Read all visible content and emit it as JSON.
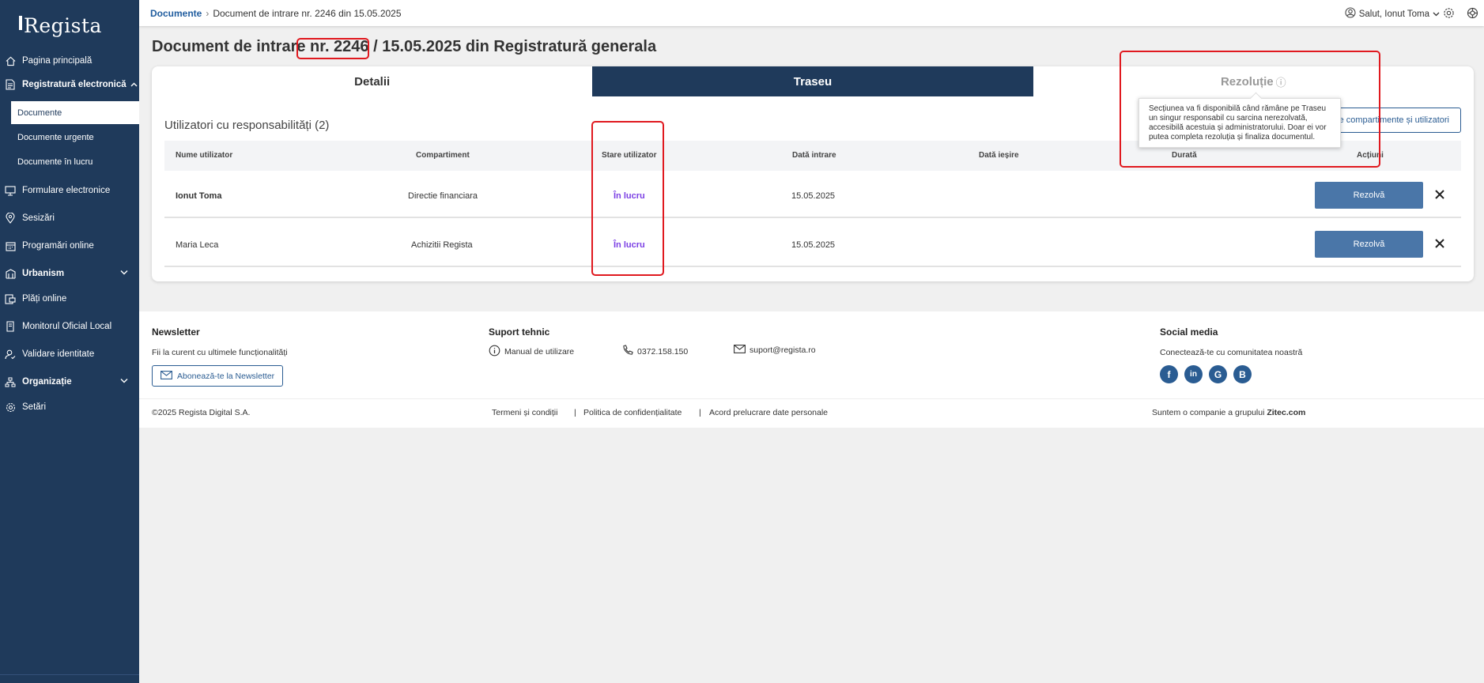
{
  "app": {
    "logo": "Regista"
  },
  "sidebar": {
    "items": [
      {
        "label": "Pagina principală"
      },
      {
        "label": "Registratură electronică"
      },
      {
        "label": "Formulare electronice"
      },
      {
        "label": "Sesizări"
      },
      {
        "label": "Programări online"
      },
      {
        "label": "Urbanism"
      },
      {
        "label": "Plăți online"
      },
      {
        "label": "Monitorul Oficial Local"
      },
      {
        "label": "Validare identitate"
      },
      {
        "label": "Organizație"
      },
      {
        "label": "Setări"
      }
    ],
    "subitems": [
      {
        "label": "Documente",
        "active": true
      },
      {
        "label": "Documente urgente"
      },
      {
        "label": "Documente în lucru"
      }
    ]
  },
  "header": {
    "breadcrumb_root": "Documente",
    "breadcrumb_sep": "›",
    "breadcrumb_current": "Document de intrare nr. 2246 din 15.05.2025",
    "user_greeting": "Salut, Ionut Toma"
  },
  "page": {
    "title_prefix": "Document de intrare ",
    "title_number": "nr. 2246",
    "title_suffix": " / 15.05.2025 din Registratură generala"
  },
  "tabs": [
    {
      "label": "Detalii"
    },
    {
      "label": "Traseu"
    },
    {
      "label": "Rezoluție",
      "info": "ⓘ"
    }
  ],
  "tooltip": {
    "text": "Secțiunea va fi disponibilă când rămâne pe Traseu un singur responsabil cu sarcina nerezolvată, accesibilă acestuia și administratorului. Doar ei vor putea completa rezoluția și finaliza documentul."
  },
  "users_section": {
    "title": "Utilizatori cu responsabilități (2)",
    "assign_button": "Atribuie compartimente și utilizatori",
    "columns": [
      "Nume utilizator",
      "Compartiment",
      "Stare utilizator",
      "Dată intrare",
      "Dată ieșire",
      "Durată",
      "Acțiuni"
    ],
    "rows": [
      {
        "name": "Ionut Toma",
        "department": "Directie financiara",
        "status": "În lucru",
        "date_in": "15.05.2025",
        "date_out": "",
        "duration": "",
        "action": "Rezolvă"
      },
      {
        "name": "Maria Leca",
        "department": "Achizitii Regista",
        "status": "În lucru",
        "date_in": "15.05.2025",
        "date_out": "",
        "duration": "",
        "action": "Rezolvă"
      }
    ]
  },
  "footer": {
    "newsletter_title": "Newsletter",
    "newsletter_text": "Fii la curent cu ultimele funcționalități",
    "newsletter_button": "Abonează-te la Newsletter",
    "support_title": "Suport tehnic",
    "manual": "Manual de utilizare",
    "phone": "0372.158.150",
    "email": "suport@regista.ro",
    "social_title": "Social media",
    "social_text": "Conectează-te cu comunitatea noastră",
    "copyright": "©2025 Regista Digital S.A.",
    "terms": "Termeni și condiții",
    "privacy": "Politica de confidențialitate",
    "gdpr": "Acord prelucrare date personale",
    "company_prefix": "Suntem o companie a grupului ",
    "company_name": "Zitec.com"
  },
  "colors": {
    "sidebar": "#1f3a5b",
    "accent": "#4a76a8",
    "status": "#7b3fe4",
    "highlight": "#e0191f"
  }
}
